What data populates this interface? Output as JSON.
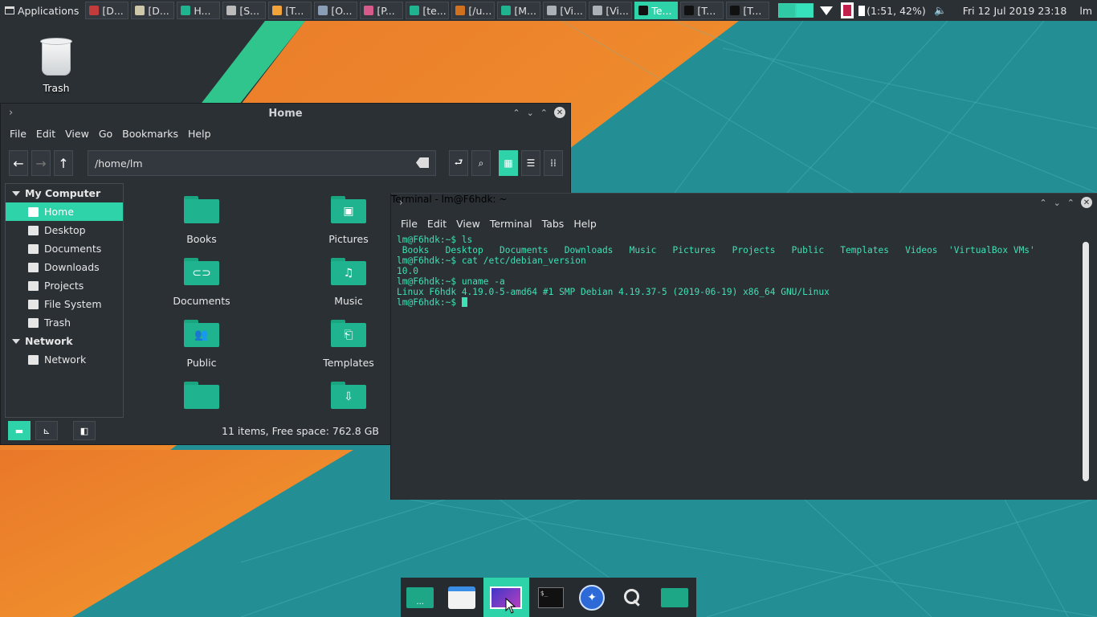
{
  "top_panel": {
    "apps_label": "Applications",
    "tasks": [
      {
        "label": "[D...",
        "color": "#c33b3b",
        "active": false
      },
      {
        "label": "[D...",
        "color": "#cfc7a9",
        "active": false
      },
      {
        "label": "H...",
        "color": "#1fb48f",
        "active": false
      },
      {
        "label": "[S...",
        "color": "#bbbbbb",
        "active": false
      },
      {
        "label": "[T...",
        "color": "#f1a33a",
        "active": false
      },
      {
        "label": "[O...",
        "color": "#8a9fb6",
        "active": false
      },
      {
        "label": "[P...",
        "color": "#d65a8a",
        "active": false
      },
      {
        "label": "[te...",
        "color": "#1fb48f",
        "active": false
      },
      {
        "label": "[/u...",
        "color": "#d1701f",
        "active": false
      },
      {
        "label": "[M...",
        "color": "#1fb48f",
        "active": false
      },
      {
        "label": "[Vi...",
        "color": "#aab0b6",
        "active": false
      },
      {
        "label": "[Vi...",
        "color": "#aab0b6",
        "active": false
      },
      {
        "label": "Te...",
        "color": "#111111",
        "active": true
      },
      {
        "label": "[T...",
        "color": "#111111",
        "active": false
      },
      {
        "label": "[T...",
        "color": "#111111",
        "active": false
      }
    ],
    "battery": "(1:51, 42%)",
    "clock": "Fri 12 Jul 2019 23:18",
    "user": "lm"
  },
  "desktop": {
    "trash_label": "Trash"
  },
  "file_manager": {
    "title": "Home",
    "menu": [
      "File",
      "Edit",
      "View",
      "Go",
      "Bookmarks",
      "Help"
    ],
    "path": "/home/lm",
    "sidebar": {
      "sections": [
        {
          "title": "My Computer",
          "items": [
            {
              "label": "Home",
              "icon": "home-icon",
              "selected": true
            },
            {
              "label": "Desktop",
              "icon": "desktop-icon"
            },
            {
              "label": "Documents",
              "icon": "document-icon"
            },
            {
              "label": "Downloads",
              "icon": "download-icon"
            },
            {
              "label": "Projects",
              "icon": "folder-icon"
            },
            {
              "label": "File System",
              "icon": "drive-icon"
            },
            {
              "label": "Trash",
              "icon": "trash-icon"
            }
          ]
        },
        {
          "title": "Network",
          "items": [
            {
              "label": "Network",
              "icon": "network-icon"
            }
          ]
        }
      ]
    },
    "folders": [
      {
        "label": "Books",
        "glyph": ""
      },
      {
        "label": "Pictures",
        "glyph": "▣"
      },
      {
        "label": "Documents",
        "glyph": "⊂⊃"
      },
      {
        "label": "Music",
        "glyph": "♫"
      },
      {
        "label": "Public",
        "glyph": "👥"
      },
      {
        "label": "Templates",
        "glyph": "⎗"
      },
      {
        "label": "",
        "glyph": ""
      },
      {
        "label": "",
        "glyph": "⇩"
      }
    ],
    "status": "11 items, Free space: 762.8 GB"
  },
  "terminal": {
    "title": "Terminal - lm@F6hdk: ~",
    "menu": [
      "File",
      "Edit",
      "View",
      "Terminal",
      "Tabs",
      "Help"
    ],
    "lines": [
      "lm@F6hdk:~$ ls",
      " Books   Desktop   Documents   Downloads   Music   Pictures   Projects   Public   Templates   Videos  'VirtualBox VMs'",
      "lm@F6hdk:~$ cat /etc/debian_version",
      "10.0",
      "lm@F6hdk:~$ uname -a",
      "Linux F6hdk 4.19.0-5-amd64 #1 SMP Debian 4.19.37-5 (2019-06-19) x86_64 GNU/Linux"
    ],
    "prompt": "lm@F6hdk:~$ "
  },
  "dock": {
    "items": [
      {
        "name": "dock-folder-app",
        "active": false
      },
      {
        "name": "dock-files-app",
        "active": false
      },
      {
        "name": "dock-screenshot-app",
        "active": true
      },
      {
        "name": "dock-terminal-app",
        "active": false
      },
      {
        "name": "dock-browser-app",
        "active": false
      },
      {
        "name": "dock-search-app",
        "active": false
      },
      {
        "name": "dock-home-folder-app",
        "active": false
      }
    ]
  },
  "colors": {
    "accent": "#2fd3a9",
    "panel": "#2b3035",
    "terminal_text": "#3fe0b5",
    "folder": "#1fb48f"
  }
}
